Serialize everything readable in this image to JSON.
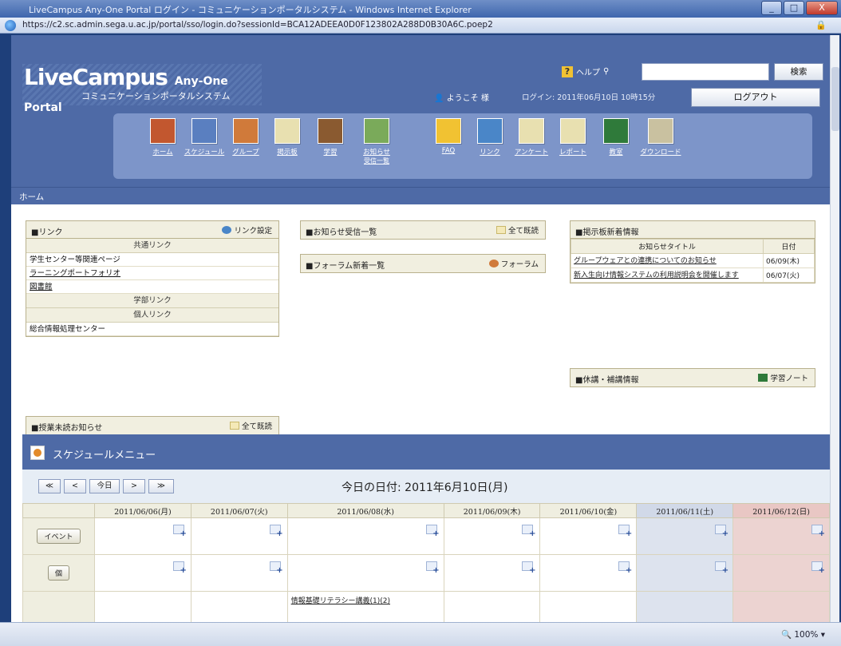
{
  "window": {
    "title": "LiveCampus Any-One Portal ログイン - コミュニケーションポータルシステム - Windows Internet Explorer",
    "url": "https://c2.sc.admin.sega.u.ac.jp/portal/sso/login.do?sessionId=BCA12ADEEA0D0F123802A288D0B30A6C.poep2",
    "minimize": "_",
    "maximize": "□",
    "close": "X",
    "zoom": "100%"
  },
  "header": {
    "brand": "LiveCampus",
    "brand_small": "Any-One Portal",
    "subtitle": "コミュニケーションポータルシステム",
    "help_label": "ヘルプ",
    "search_button": "検索",
    "user": "ようこそ 様",
    "login_time": "ログイン: 2011年06月10日 10時15分",
    "logout": "ログアウト"
  },
  "menu": [
    {
      "label": "ホーム",
      "color": "#c2572f"
    },
    {
      "label": "スケジュール",
      "color": "#5a7fc0"
    },
    {
      "label": "グループ",
      "color": "#d07a3a"
    },
    {
      "label": "掲示板",
      "color": "#e8e0b0"
    },
    {
      "label": "学習",
      "color": "#8a5a30"
    },
    {
      "label": "お知らせ",
      "label2": "受信一覧",
      "color": "#7aaa5a"
    },
    {
      "label": "FAQ",
      "color": "#f1c232"
    },
    {
      "label": "リンク",
      "color": "#4a86c8"
    },
    {
      "label": "アンケート",
      "color": "#e8e0b0"
    },
    {
      "label": "レポート",
      "color": "#e8e0b0"
    },
    {
      "label": "教室",
      "color": "#2f7a3a"
    },
    {
      "label": "ダウンロード",
      "color": "#c9c1a0"
    }
  ],
  "breadcrumb": "ホーム",
  "links_panel": {
    "title": "■リンク",
    "button": "リンク設定",
    "section1": "共通リンク",
    "items": [
      "学生センター等関連ページ",
      "ラーニングポートフォリオ",
      "図書館"
    ],
    "section2": "学部リンク",
    "section3": "個人リンク",
    "items3": [
      "総合情報処理センター"
    ]
  },
  "unread_panel": {
    "title": "■授業未読お知らせ",
    "button": "全て既読"
  },
  "news_panel": {
    "title": "■お知らせ受信一覧",
    "button": "全て既読"
  },
  "forum_panel": {
    "title": "■フォーラム新着一覧",
    "button": "フォーラム"
  },
  "notice_panel": {
    "title": "■掲示板新着情報",
    "col1": "お知らせタイトル",
    "col2": "日付",
    "rows": [
      {
        "title": "グループウェアとの連携についてのお知らせ",
        "date": "06/09(木)"
      },
      {
        "title": "新入生向け情報システムの利用説明会を開催します",
        "date": "06/07(火)"
      }
    ]
  },
  "lecture_panel": {
    "title": "■休講・補講情報",
    "button": "学習ノート"
  },
  "schedule": {
    "title": "スケジュールメニュー",
    "nav": [
      "≪",
      "<",
      "今日",
      ">",
      "≫"
    ],
    "today_label": "今日の日付: 2011年6月10日(月)",
    "days": [
      {
        "date": "2011/06/06(月)",
        "type": "weekday"
      },
      {
        "date": "2011/06/07(火)",
        "type": "weekday"
      },
      {
        "date": "2011/06/08(水)",
        "type": "weekday"
      },
      {
        "date": "2011/06/09(木)",
        "type": "weekday"
      },
      {
        "date": "2011/06/10(金)",
        "type": "weekday"
      },
      {
        "date": "2011/06/11(土)",
        "type": "sat"
      },
      {
        "date": "2011/06/12(日)",
        "type": "sun"
      }
    ],
    "row_labels": [
      "イベント",
      "個"
    ],
    "event": "情報基礎リテラシー講義(1)(2)"
  }
}
